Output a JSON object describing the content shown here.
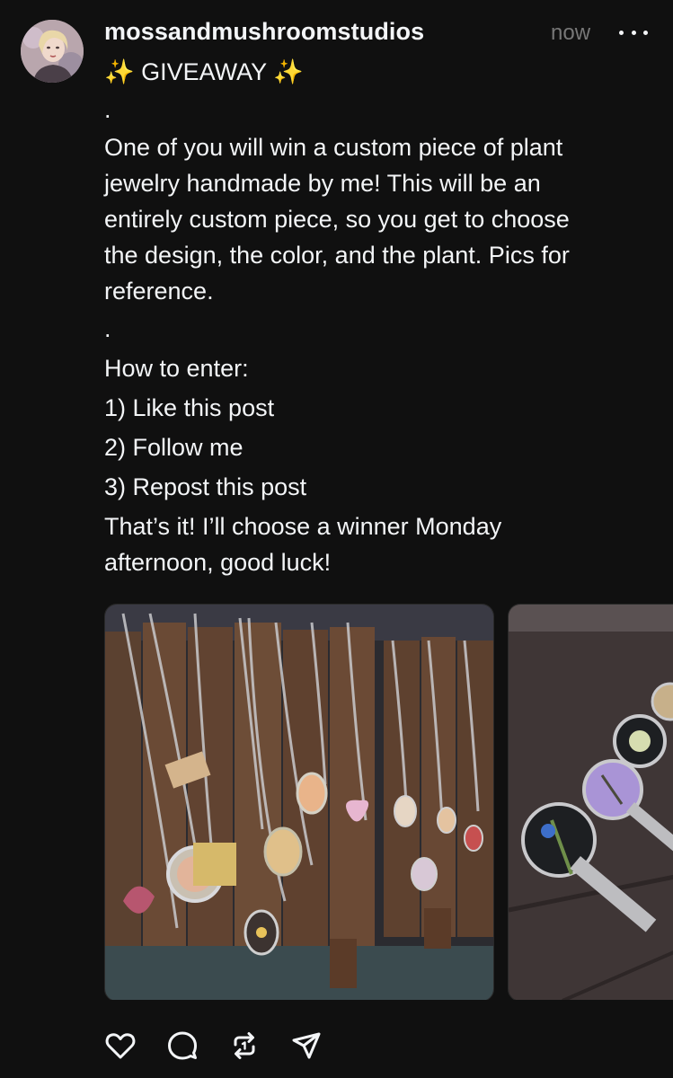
{
  "post": {
    "username": "mossandmushroomstudios",
    "timestamp": "now",
    "more_icon": "more-horizontal-icon",
    "text": {
      "title_sparkle_left": "✨",
      "title": "GIVEAWAY",
      "title_sparkle_right": "✨",
      "dot_1": ".",
      "paragraph_lines": [
        "One of you will win a custom piece of plant",
        "jewelry handmade by me! This will be an",
        "entirely custom piece, so you get to choose",
        "the design, the color, and the plant. Pics for",
        "reference."
      ],
      "dot_2": ".",
      "how_to_enter": "How to enter:",
      "step_1": "1) Like this post",
      "step_2": "2) Follow me",
      "step_3": "3) Repost this post",
      "closing_lines": [
        "That’s it! I’ll choose a winner Monday",
        "afternoon, good luck!"
      ]
    },
    "media": [
      {
        "description_icon": "photo-necklaces-display"
      },
      {
        "description_icon": "photo-key-pendants"
      }
    ],
    "actions": [
      {
        "icon": "heart-icon"
      },
      {
        "icon": "comment-icon"
      },
      {
        "icon": "repost-icon"
      },
      {
        "icon": "share-icon"
      }
    ]
  },
  "colors": {
    "background": "#101010",
    "text_primary": "#f3f5f7",
    "text_secondary": "#777777"
  }
}
